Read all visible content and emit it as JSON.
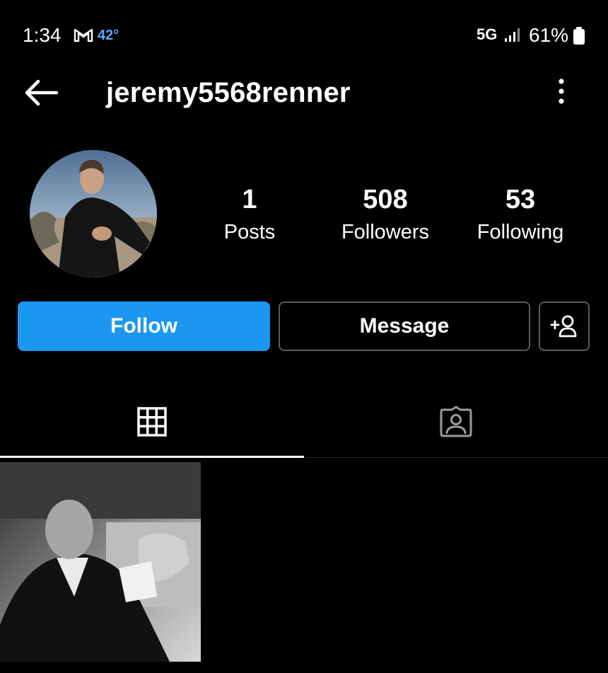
{
  "status_bar": {
    "time": "1:34",
    "temperature": "42°",
    "network": "5G",
    "battery_percent": "61%",
    "icons": [
      "gmail-icon",
      "signal-icon",
      "battery-icon"
    ]
  },
  "header": {
    "username": "jeremy5568renner",
    "icons": [
      "back-arrow-icon",
      "more-vertical-icon"
    ]
  },
  "profile": {
    "stats": [
      {
        "value": "1",
        "label": "Posts"
      },
      {
        "value": "508",
        "label": "Followers"
      },
      {
        "value": "53",
        "label": "Following"
      }
    ]
  },
  "actions": {
    "follow_label": "Follow",
    "message_label": "Message",
    "add_icon": "add-person-icon"
  },
  "tabs": [
    {
      "icon": "grid-icon",
      "active": true
    },
    {
      "icon": "tagged-person-icon",
      "active": false
    }
  ],
  "posts": [
    {
      "icon": "post-photo"
    }
  ],
  "colors": {
    "background": "#000000",
    "accent": "#1b97f0",
    "border": "#5b5b5b",
    "temperature": "#5aa7ff"
  }
}
